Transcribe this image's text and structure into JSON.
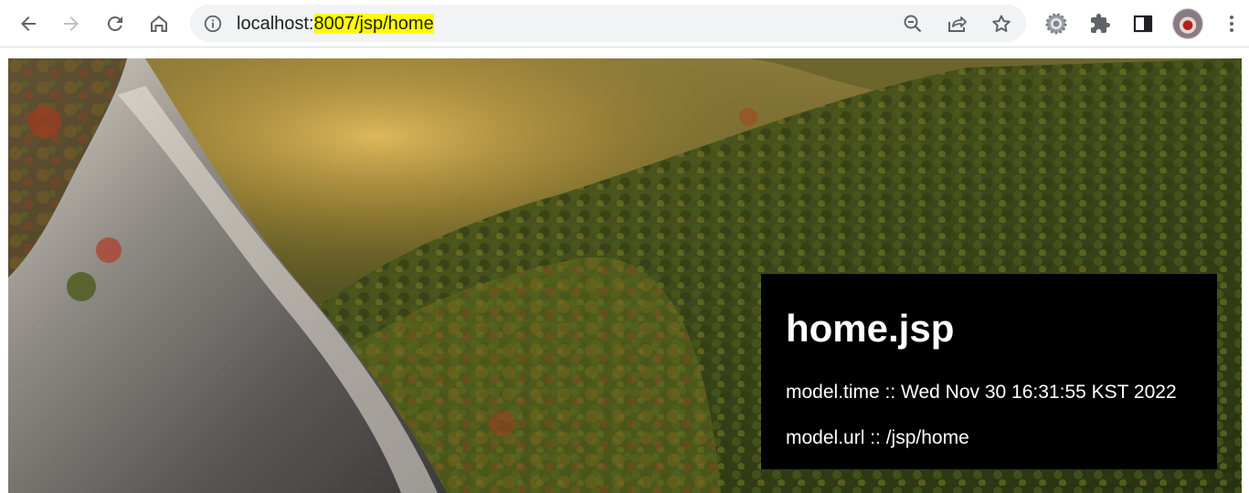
{
  "browser": {
    "url_plain": "localhost:",
    "url_highlighted": "8007/jsp/home",
    "highlight_color": "#ffff00",
    "icons": {
      "back": "arrow-left-icon",
      "forward": "arrow-right-icon",
      "reload": "reload-icon",
      "home": "home-icon",
      "site_info": "info-icon",
      "zoom": "zoom-out-icon",
      "share": "share-icon",
      "bookmark": "star-icon",
      "extension_1": "gear-icon",
      "extensions": "puzzle-icon",
      "side_panel": "side-panel-icon",
      "profile": "avatar",
      "menu": "kebab-menu-icon"
    }
  },
  "page": {
    "title": "home.jsp",
    "time_label": "model.time",
    "time_sep": " :: ",
    "time_value": "Wed Nov 30 16:31:55 KST 2022",
    "url_label": "model.url",
    "url_sep": " :: ",
    "url_value": "/jsp/home",
    "box_color": "#000000",
    "text_color": "#ffffff"
  }
}
